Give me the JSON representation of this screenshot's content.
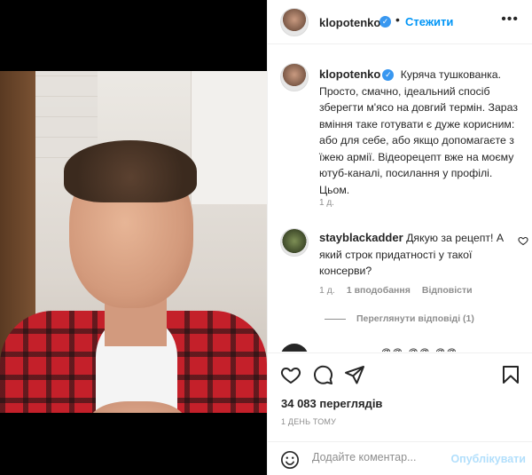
{
  "post": {
    "username": "klopotenko",
    "dot": "•",
    "follow_label": "Стежити",
    "caption": "Куряча тушкованка. Просто, смачно, ідеальний спосіб зберегти м'ясо на довгий термін. Зараз вміння таке готувати є дуже корисним: або для себе, або якщо допомагаєте з їжею армії. Відеорецепт вже на моєму ютуб-каналі, посилання у профілі. Цьом.",
    "caption_time": "1 д.",
    "views": "34 083 переглядів",
    "posted": "1 ДЕНЬ ТОМУ"
  },
  "comment": {
    "username": "stayblackadder",
    "text": "Дякую за рецепт! А який строк придатності у такої консерви?",
    "time": "1 д.",
    "likes": "1 вподобання",
    "reply": "Відповісти",
    "view_replies": "Переглянути відповіді (1)"
  },
  "next_comment": {
    "partial_text": "@@ @@ @@"
  },
  "add_comment": {
    "placeholder": "Додайте коментар...",
    "publish": "Опублікувати"
  },
  "icons": {
    "more": "more-options-icon",
    "verified": "verified-badge-icon",
    "like": "heart-icon",
    "comment": "comment-icon",
    "share": "share-icon",
    "save": "bookmark-icon",
    "emoji": "emoji-icon"
  },
  "colors": {
    "link": "#0095f6",
    "verified": "#3897f0",
    "muted": "#8e8e8e",
    "publish_disabled": "#b2dffc"
  }
}
